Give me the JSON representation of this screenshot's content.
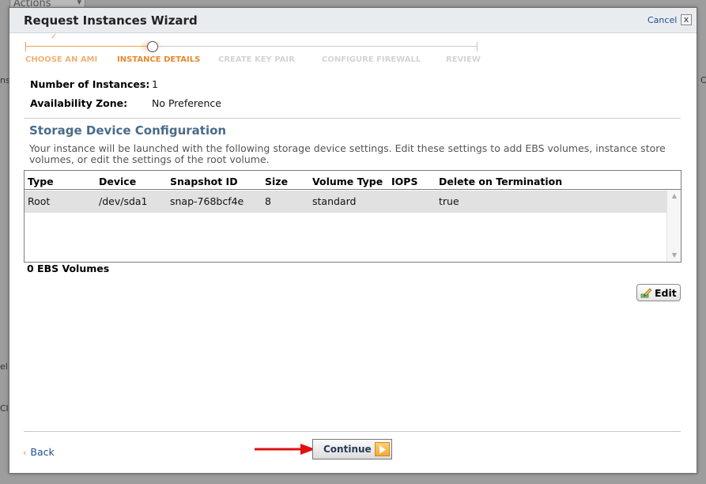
{
  "background": {
    "actions_label": "Actions",
    "fragments": [
      "ns",
      "C",
      "el",
      "Cl"
    ]
  },
  "dialog": {
    "title": "Request Instances Wizard",
    "cancel_label": "Cancel",
    "close_glyph": "x"
  },
  "steps": [
    {
      "label": "CHOOSE AN AMI",
      "state": "done",
      "check": "✓"
    },
    {
      "label": "INSTANCE DETAILS",
      "state": "current"
    },
    {
      "label": "CREATE KEY PAIR",
      "state": "todo"
    },
    {
      "label": "CONFIGURE FIREWALL",
      "state": "todo"
    },
    {
      "label": "REVIEW",
      "state": "todo"
    }
  ],
  "fields": {
    "instances_label": "Number of Instances:",
    "instances_value": "1",
    "zone_label": "Availability Zone:",
    "zone_value": "No Preference"
  },
  "storage": {
    "title": "Storage Device Configuration",
    "description": "Your instance will be launched with the following storage device settings. Edit these settings to add EBS volumes, instance store volumes, or edit the settings of the root volume.",
    "columns": [
      "Type",
      "Device",
      "Snapshot ID",
      "Size",
      "Volume Type",
      "IOPS",
      "Delete on Termination"
    ],
    "rows": [
      {
        "type": "Root",
        "device": "/dev/sda1",
        "snapshot": "snap-768bcf4e",
        "size": "8",
        "volume_type": "standard",
        "iops": "",
        "delete": "true"
      }
    ],
    "ebs_count": "0 EBS Volumes",
    "edit_label": "Edit"
  },
  "footer": {
    "back_glyph": "‹",
    "back_label": "Back",
    "continue_label": "Continue"
  },
  "colors": {
    "accent_orange": "#e8892c",
    "link_blue": "#1d4f91",
    "section_title": "#4a6b8a",
    "annotation_red": "#e01010"
  },
  "icons": [
    "check-icon",
    "close-icon",
    "pencil-icon",
    "chevron-left-icon",
    "play-arrow-icon",
    "red-pointer-arrow",
    "scroll-up-icon",
    "scroll-down-icon"
  ]
}
